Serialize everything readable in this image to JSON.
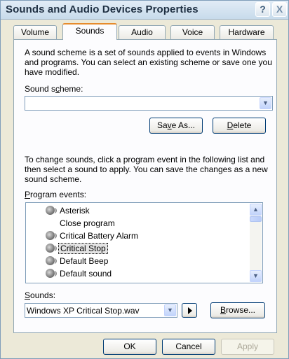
{
  "window": {
    "title": "Sounds and Audio Devices Properties",
    "help_button": "?",
    "close_button": "X"
  },
  "tabs": [
    "Volume",
    "Sounds",
    "Audio",
    "Voice",
    "Hardware"
  ],
  "active_tab": "Sounds",
  "sounds_tab": {
    "intro_lines": [
      "A sound scheme is a set of sounds applied to events in Windows",
      "and programs. You can select an existing scheme or save one you",
      "have modified."
    ],
    "scheme_label_pre": "Sound s",
    "scheme_label_key": "c",
    "scheme_label_post": "heme:",
    "scheme_value": "",
    "save_as_pre": "Sa",
    "save_as_key": "v",
    "save_as_post": "e As...",
    "delete_key": "D",
    "delete_post": "elete",
    "change_lines": [
      "To change sounds, click a program event in the following list and",
      "then select a sound to apply. You can save the changes as a new",
      "sound scheme."
    ],
    "events_label_key": "P",
    "events_label_post": "rogram events:",
    "events": [
      {
        "label": "Asterisk",
        "icon": true,
        "selected": false
      },
      {
        "label": "Close program",
        "icon": false,
        "selected": false
      },
      {
        "label": "Critical Battery Alarm",
        "icon": true,
        "selected": false
      },
      {
        "label": "Critical Stop",
        "icon": true,
        "selected": true
      },
      {
        "label": "Default Beep",
        "icon": true,
        "selected": false
      },
      {
        "label": "Default sound",
        "icon": true,
        "selected": false
      }
    ],
    "sounds_label_key": "S",
    "sounds_label_post": "ounds:",
    "sound_value": "Windows XP Critical Stop.wav",
    "browse_key": "B",
    "browse_post": "rowse..."
  },
  "footer": {
    "ok": "OK",
    "cancel": "Cancel",
    "apply": "Apply"
  }
}
